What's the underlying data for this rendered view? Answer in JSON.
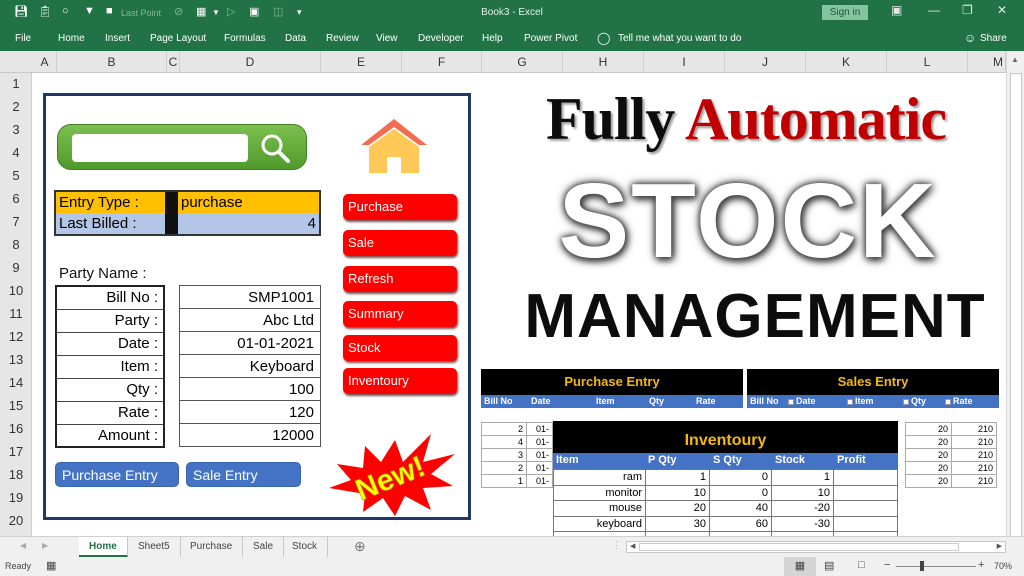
{
  "window": {
    "title": "Book3  -  Excel",
    "sign_in": "Sign in",
    "quick_access": {
      "last_point": "Last Point"
    }
  },
  "ribbon": {
    "tabs": [
      "File",
      "Home",
      "Insert",
      "Page Layout",
      "Formulas",
      "Data",
      "Review",
      "View",
      "Developer",
      "Help",
      "Power Pivot"
    ],
    "tell_me": "Tell me what you want to do",
    "share": "Share"
  },
  "columns": [
    "A",
    "B",
    "C",
    "D",
    "E",
    "F",
    "G",
    "H",
    "I",
    "J",
    "K",
    "L",
    "M"
  ],
  "rows": [
    "1",
    "2",
    "3",
    "4",
    "5",
    "6",
    "7",
    "8",
    "9",
    "10",
    "11",
    "12",
    "13",
    "14",
    "15",
    "16",
    "17",
    "18",
    "19",
    "20"
  ],
  "dashboard": {
    "search": {
      "value": ""
    },
    "entry_type": {
      "label": "Entry Type :",
      "value": "purchase"
    },
    "last_billed": {
      "label": "Last Billed :",
      "value": "4"
    },
    "party_name_label": "Party Name :",
    "fields": [
      {
        "label": "Bill No :",
        "value": "SMP1001"
      },
      {
        "label": "Party :",
        "value": "Abc Ltd"
      },
      {
        "label": "Date :",
        "value": "01-01-2021"
      },
      {
        "label": "Item :",
        "value": "Keyboard"
      },
      {
        "label": "Qty :",
        "value": "100"
      },
      {
        "label": "Rate :",
        "value": "120"
      },
      {
        "label": "Amount :",
        "value": "12000"
      }
    ],
    "nav_buttons": [
      "Purchase",
      "Sale",
      "Refresh",
      "Summary",
      "Stock",
      "Inventoury"
    ],
    "purchase_entry_button": "Purchase Entry",
    "sale_entry_button": "Sale Entry",
    "new_badge": "New!"
  },
  "hero": {
    "line1_a": "Fully",
    "line1_b": "Automatic",
    "line2": "STOCK",
    "line3": "MANAGEMENT"
  },
  "purchase_entry": {
    "title": "Purchase Entry",
    "headers": [
      "Bill No",
      "Date",
      "Item",
      "Qty",
      "Rate"
    ],
    "rows": [
      [
        "2",
        "01-"
      ],
      [
        "4",
        "01-"
      ],
      [
        "3",
        "01-"
      ],
      [
        "2",
        "01-"
      ],
      [
        "1",
        "01-"
      ]
    ]
  },
  "sales_entry": {
    "title": "Sales Entry",
    "headers": [
      "Bill No",
      "Date",
      "Item",
      "Qty",
      "Rate"
    ],
    "rows": [
      [
        "20",
        "210"
      ],
      [
        "20",
        "210"
      ],
      [
        "20",
        "210"
      ],
      [
        "20",
        "210"
      ],
      [
        "20",
        "210"
      ]
    ]
  },
  "inventory": {
    "title": "Inventoury",
    "headers": [
      "Item",
      "P Qty",
      "S Qty",
      "Stock",
      "Profit"
    ],
    "rows": [
      [
        "ram",
        "1",
        "0",
        "1",
        ""
      ],
      [
        "monitor",
        "10",
        "0",
        "10",
        ""
      ],
      [
        "mouse",
        "20",
        "40",
        "-20",
        ""
      ],
      [
        "keyboard",
        "30",
        "60",
        "-30",
        ""
      ]
    ]
  },
  "sheet_tabs": [
    "Home",
    "Sheet5",
    "Purchase",
    "Sale",
    "Stock"
  ],
  "active_sheet": "Home",
  "status": {
    "text": "Ready",
    "zoom": "70%"
  },
  "colors": {
    "excel_green": "#217346",
    "red_button": "#ff0000",
    "blue_button": "#4472c4",
    "yellow_cell": "#ffc000",
    "light_blue_cell": "#b4c6e7"
  }
}
